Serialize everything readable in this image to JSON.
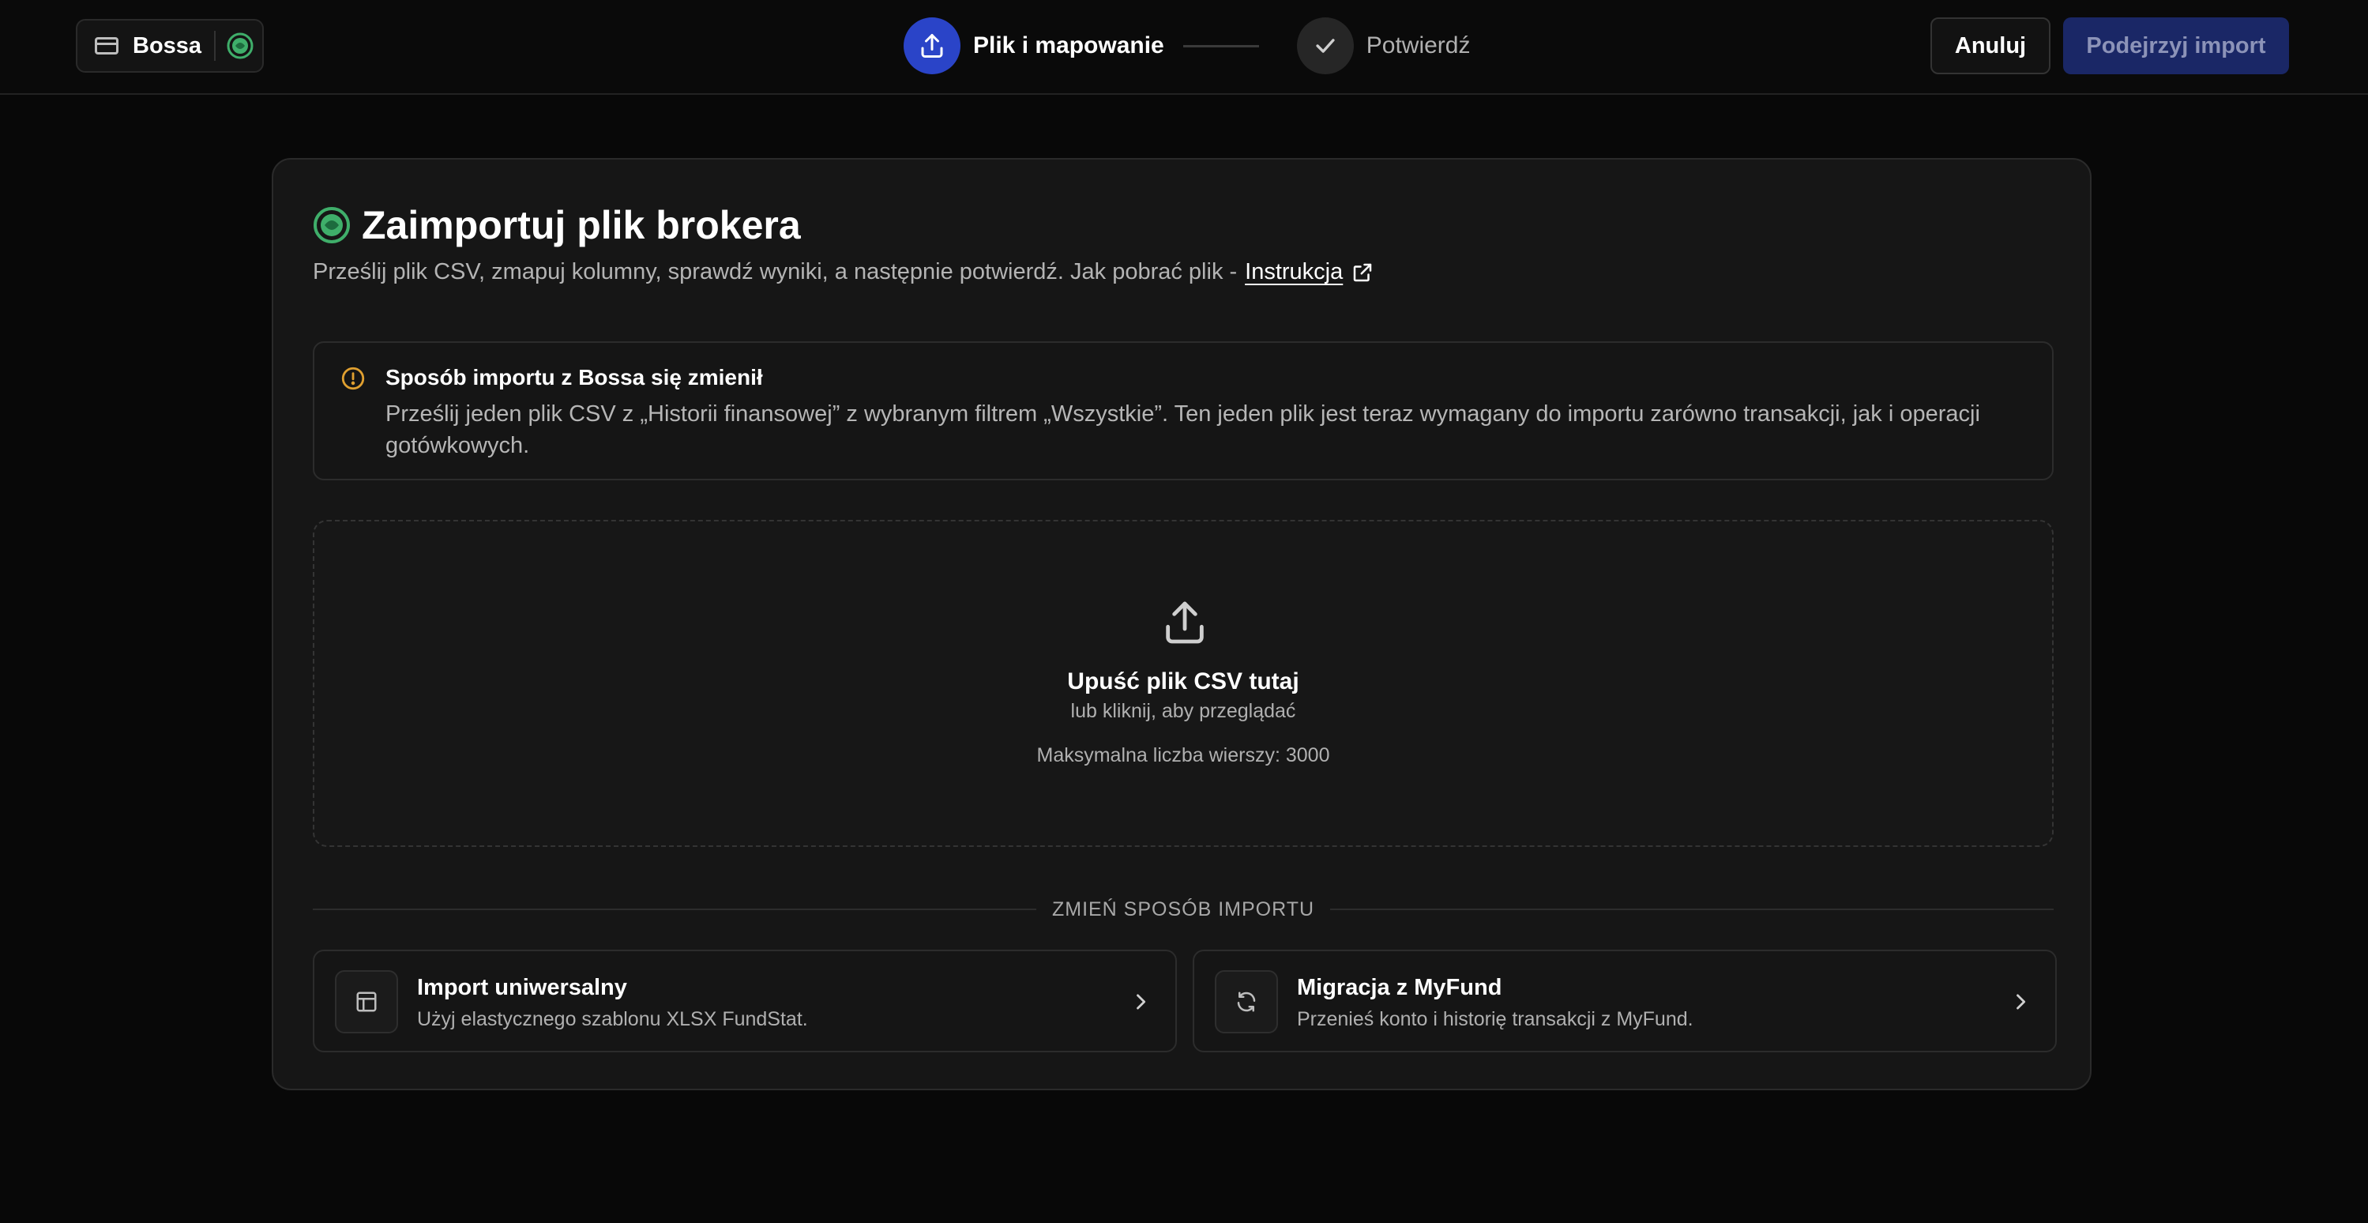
{
  "topbar": {
    "account_name": "Bossa",
    "steps": [
      {
        "label": "Plik i mapowanie",
        "state": "active"
      },
      {
        "label": "Potwierdź",
        "state": "done"
      }
    ],
    "cancel_label": "Anuluj",
    "preview_label": "Podejrzyj import"
  },
  "main": {
    "title": "Zaimportuj plik brokera",
    "subtitle": "Prześlij plik CSV, zmapuj kolumny, sprawdź wyniki, a następnie potwierdź. Jak pobrać plik -",
    "instructions_link": "Instrukcja",
    "notice": {
      "title": "Sposób importu z Bossa się zmienił",
      "body": "Prześlij jeden plik CSV z „Historii finansowej” z wybranym filtrem „Wszystkie”. Ten jeden plik jest teraz wymagany do importu zarówno transakcji, jak i operacji gotówkowych."
    },
    "dropzone": {
      "title": "Upuść plik CSV tutaj",
      "subtitle": "lub kliknij, aby przeglądać",
      "limit": "Maksymalna liczba wierszy: 3000"
    },
    "divider_label": "ZMIEŃ SPOSÓB IMPORTU",
    "options": [
      {
        "title": "Import uniwersalny",
        "description": "Użyj elastycznego szablonu XLSX FundStat.",
        "icon": "table-icon"
      },
      {
        "title": "Migracja z MyFund",
        "description": "Przenieś konto i historię transakcji z MyFund.",
        "icon": "refresh-icon"
      }
    ]
  },
  "colors": {
    "accent": "#2a44c8",
    "brand_green": "#3fae6a",
    "warning": "#e0a030",
    "background": "#080808",
    "card": "#161616"
  }
}
